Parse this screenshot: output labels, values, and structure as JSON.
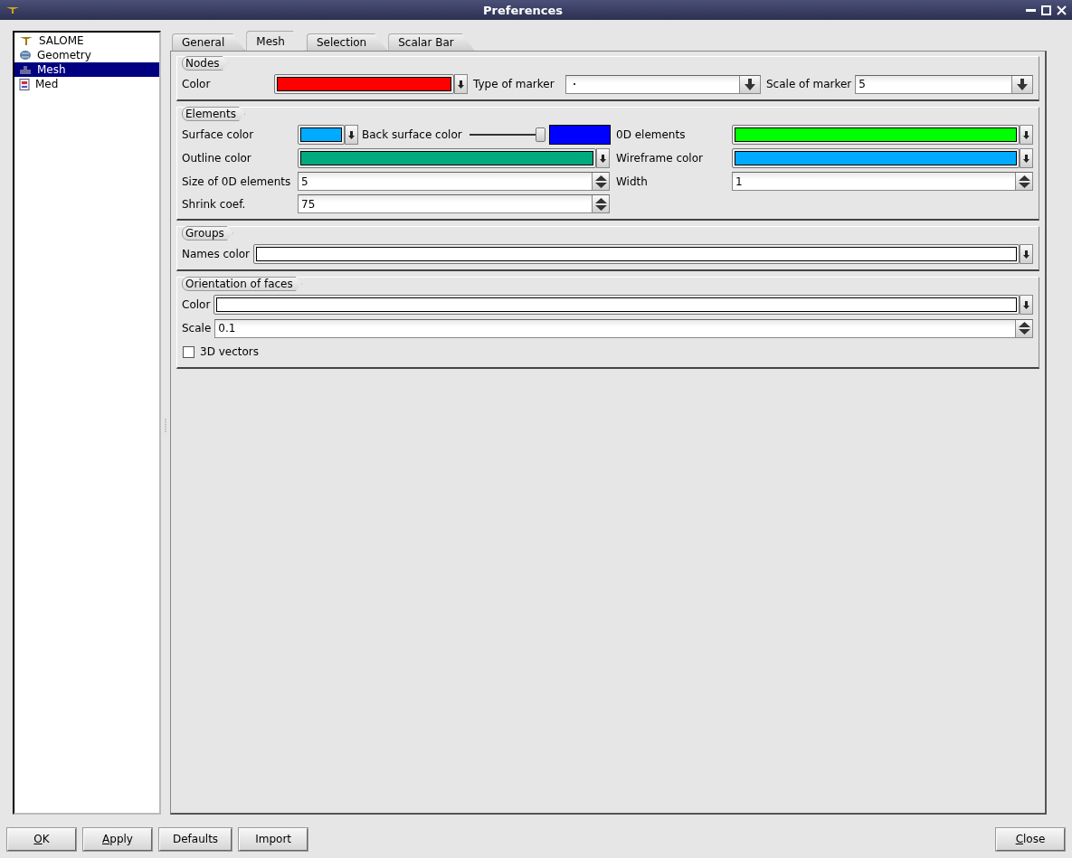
{
  "window": {
    "title": "Preferences"
  },
  "tree": [
    {
      "label": "SALOME",
      "kind": "lamp",
      "selected": false
    },
    {
      "label": "Geometry",
      "kind": "globe",
      "selected": false
    },
    {
      "label": "Mesh",
      "kind": "mesh",
      "selected": true
    },
    {
      "label": "Med",
      "kind": "document",
      "selected": false
    }
  ],
  "tabs": [
    {
      "label": "General",
      "selected": false
    },
    {
      "label": "Mesh",
      "selected": true
    },
    {
      "label": "Selection",
      "selected": false
    },
    {
      "label": "Scalar Bar",
      "selected": false
    }
  ],
  "nodes": {
    "title": "Nodes",
    "color_field": {
      "label": "Color",
      "color": "#ff0000"
    },
    "marker_label": "Type of marker",
    "scale_label": "Scale of marker",
    "scale_value": "5"
  },
  "elements": {
    "title": "Elements",
    "surface": {
      "label": "Surface color",
      "color": "#00aaff"
    },
    "back_label": "Back surface color",
    "back_slider": {
      "level": 1
    },
    "back_swatch": {
      "color": "#0000ff"
    },
    "od": {
      "label": "0D elements",
      "color": "#00ff00"
    },
    "outline": {
      "label": "Outline color",
      "color": "#00aa7f"
    },
    "wire": {
      "label": "Wireframe color",
      "color": "#00aaff"
    },
    "size_label": "Size of 0D elements",
    "size_value": "5",
    "width_label": "Width",
    "width_value": "1",
    "shrink_label": "Shrink coef.",
    "shrink_value": "75"
  },
  "groups": {
    "title": "Groups",
    "names": {
      "label": "Names color",
      "color": "#ffffff"
    }
  },
  "orientation": {
    "title": "Orientation of faces",
    "color_field": {
      "label": "Color",
      "color": "#ffffff"
    },
    "scale_label": "Scale",
    "scale_value": "0.1",
    "vectors": {
      "label": "3D vectors",
      "checked": false
    }
  },
  "buttons": [
    {
      "label": "OK",
      "underline_first": true
    },
    {
      "label": "Apply",
      "underline_first": true
    },
    {
      "label": "Defaults",
      "underline_first": false
    },
    {
      "label": "Import",
      "underline_first": false
    }
  ],
  "close_button": {
    "label": "Close",
    "underline_first": true
  }
}
